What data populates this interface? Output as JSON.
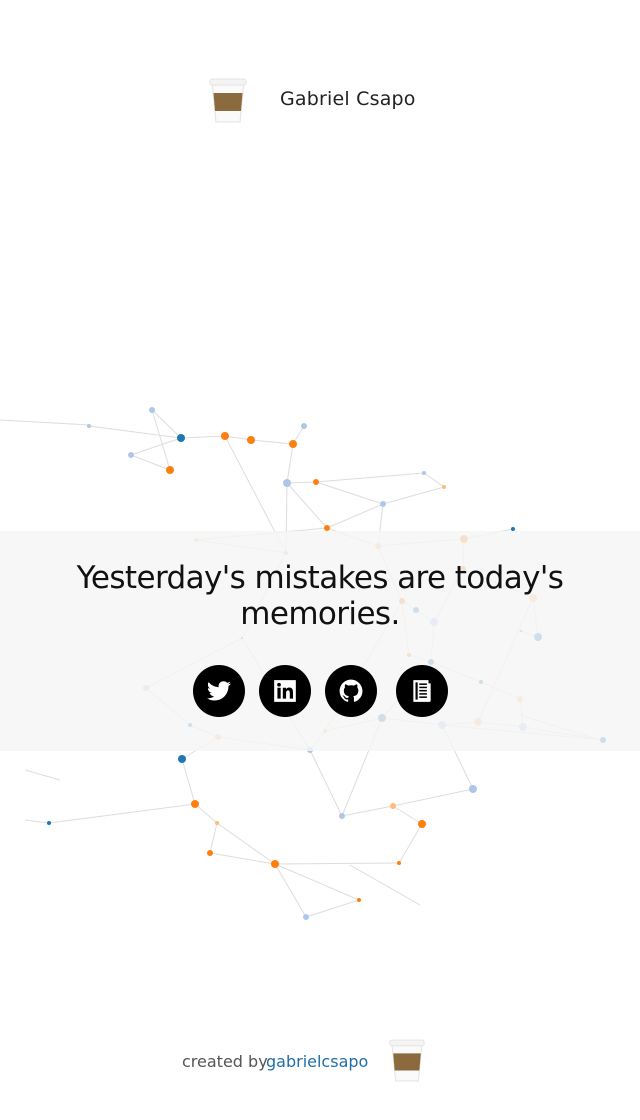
{
  "header": {
    "site_name": "Gabriel Csapo",
    "logo_icon": "coffee-cup-icon"
  },
  "quote": {
    "line1": "Yesterday's mistakes are today's",
    "line2": "memories."
  },
  "social": [
    {
      "name": "twitter",
      "icon": "twitter-icon"
    },
    {
      "name": "linkedin",
      "icon": "linkedin-icon"
    },
    {
      "name": "github",
      "icon": "github-icon"
    },
    {
      "name": "blog",
      "icon": "newspaper-icon"
    }
  ],
  "footer": {
    "created_by": "created by",
    "author": "gabrielcsapo",
    "logo_icon": "coffee-cup-icon"
  },
  "colors": {
    "band": "#f5f5f5",
    "link": "#1f6fa8",
    "node_orange": "#ff7f0e",
    "node_blue": "#1f77b4",
    "node_light_blue": "#aec7e8",
    "node_light_orange": "#ffbb78",
    "edge": "#dddddd"
  }
}
